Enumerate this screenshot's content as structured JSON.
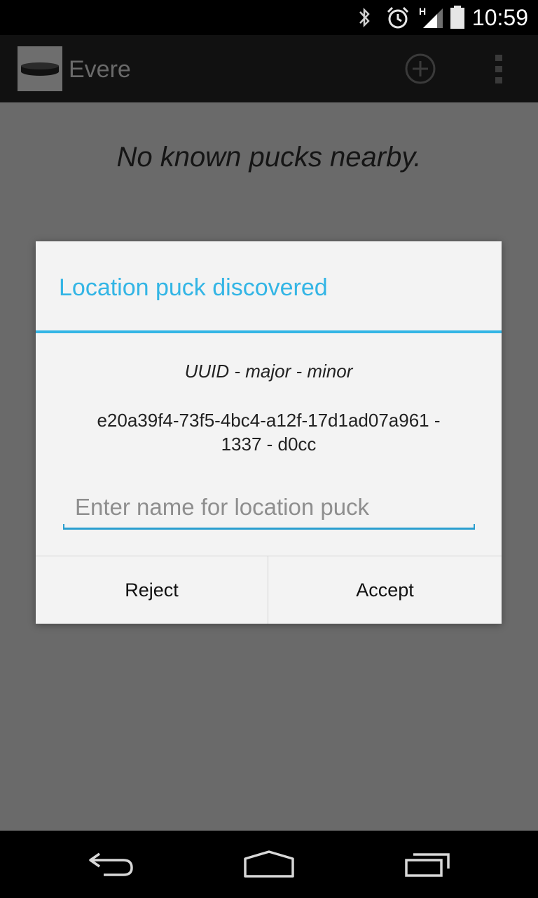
{
  "status_bar": {
    "time": "10:59",
    "network_type": "H",
    "icons": [
      "bluetooth-icon",
      "alarm-icon",
      "signal-icon",
      "battery-icon"
    ]
  },
  "action_bar": {
    "app_title": "Evere",
    "actions": [
      "add-icon",
      "overflow-menu-icon"
    ]
  },
  "main": {
    "empty_message": "No known pucks nearby."
  },
  "dialog": {
    "title": "Location puck discovered",
    "label": "UUID - major - minor",
    "value_line1": "e20a39f4-73f5-4bc4-a12f-17d1ad07a961 -",
    "value_line2": "1337 - d0cc",
    "input": {
      "value": "",
      "placeholder": "Enter name for location puck"
    },
    "reject_label": "Reject",
    "accept_label": "Accept"
  },
  "nav_bar": {
    "buttons": [
      "back-icon",
      "home-icon",
      "recent-apps-icon"
    ]
  },
  "colors": {
    "accent": "#33b5e5",
    "scrim_background": "#6a6a6a",
    "dialog_background": "#f3f3f3"
  }
}
